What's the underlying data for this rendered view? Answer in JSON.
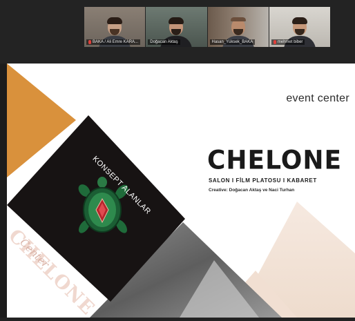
{
  "participants": [
    {
      "name": "BAKA / Ali Emre KARA...",
      "active": false,
      "muted": true
    },
    {
      "name": "Doğacan Aktaş",
      "active": true,
      "muted": false
    },
    {
      "name": "Hasan_Yüksek_BAKA",
      "active": false,
      "muted": false
    },
    {
      "name": "mehmet biber",
      "active": false,
      "muted": true
    }
  ],
  "slide": {
    "event_label": "event center",
    "brand": "CHELONE",
    "subtitle": "SALON  I FİLM PLATOSU I KABARET",
    "creative": "Creative: Doğacan Aktaş ve Naci Turhan",
    "diagonal_label": "KONSEPT ALANLAR",
    "logo_main": "CHELONE",
    "logo_sub": "Center"
  },
  "colors": {
    "accent_orange": "#d9913c",
    "dark": "#171313",
    "active_border": "#2fd45a"
  }
}
